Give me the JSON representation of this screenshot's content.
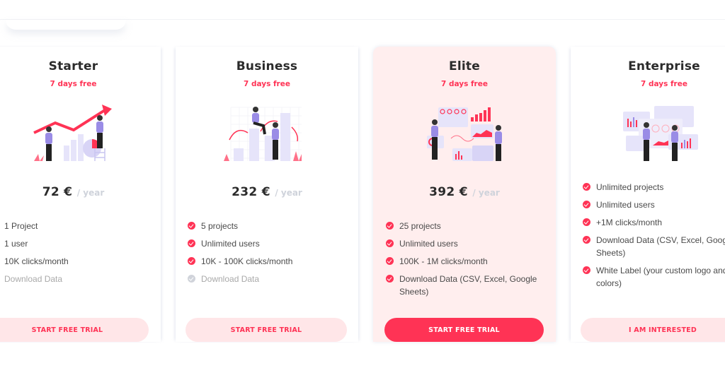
{
  "colors": {
    "accent": "#ff3355",
    "accent_soft": "#ffe6e8",
    "highlight_card": "#ffeeee",
    "title_text": "#2b2b2b",
    "period_text": "#cfd3db",
    "muted_text": "#a9a9a9",
    "illustration_purple": "#9a8ce6",
    "illustration_lavender": "#e6e4fa"
  },
  "plans": [
    {
      "name": "Starter",
      "trial": "7 days free",
      "illustration": "growth-chart-illustration",
      "price": "72 €",
      "period": "/ year",
      "features": [
        {
          "text": "1 Project",
          "included": true
        },
        {
          "text": "1 user",
          "included": true
        },
        {
          "text": "10K clicks/month",
          "included": true
        },
        {
          "text": "Download Data",
          "included": false
        }
      ],
      "cta": "START FREE TRIAL",
      "highlighted": false
    },
    {
      "name": "Business",
      "trial": "7 days free",
      "illustration": "bar-chart-team-illustration",
      "price": "232 €",
      "period": "/ year",
      "features": [
        {
          "text": "5 projects",
          "included": true
        },
        {
          "text": "Unlimited users",
          "included": true
        },
        {
          "text": "10K - 100K clicks/month",
          "included": true
        },
        {
          "text": "Download Data",
          "included": false
        }
      ],
      "cta": "START FREE TRIAL",
      "highlighted": false
    },
    {
      "name": "Elite",
      "trial": "7 days free",
      "illustration": "dashboard-analytics-illustration",
      "price": "392 €",
      "period": "/ year",
      "features": [
        {
          "text": "25 projects",
          "included": true
        },
        {
          "text": "Unlimited users",
          "included": true
        },
        {
          "text": "100K - 1M clicks/month",
          "included": true
        },
        {
          "text": "Download Data (CSV, Excel, Google Sheets)",
          "included": true
        }
      ],
      "cta": "START FREE TRIAL",
      "highlighted": true
    },
    {
      "name": "Enterprise",
      "trial": "7 days free",
      "illustration": "enterprise-dashboard-illustration",
      "features": [
        {
          "text": "Unlimited projects",
          "included": true
        },
        {
          "text": "Unlimited users",
          "included": true
        },
        {
          "text": "+1M clicks/month",
          "included": true
        },
        {
          "text": "Download Data (CSV, Excel, Google Sheets)",
          "included": true
        },
        {
          "text": "White Label (your custom logo and brand colors)",
          "included": true
        }
      ],
      "cta": "I AM INTERESTED",
      "highlighted": false
    }
  ]
}
